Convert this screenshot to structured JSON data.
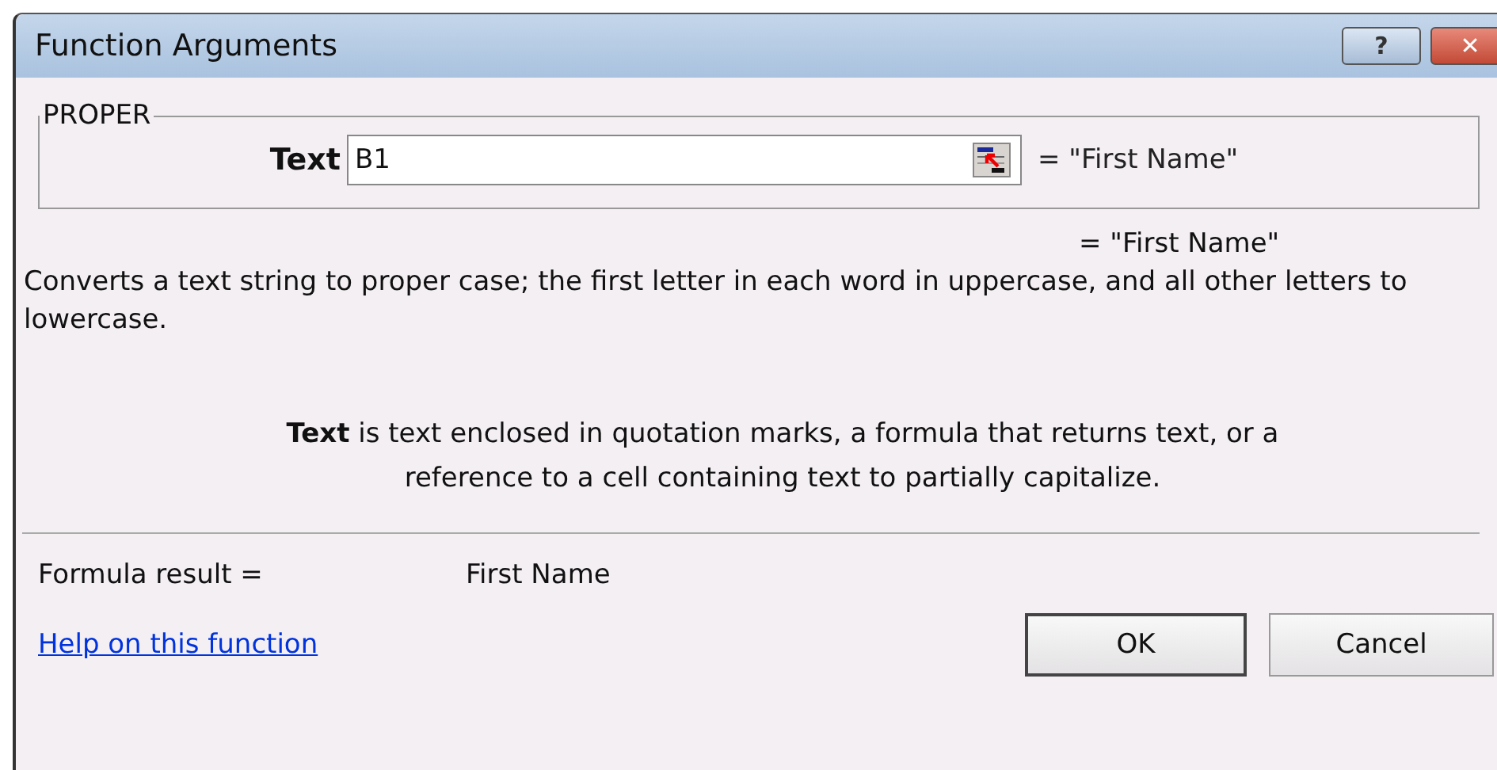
{
  "window": {
    "title": "Function Arguments",
    "help_button": "?",
    "close_button": "✕"
  },
  "function_group": {
    "title": "PROPER",
    "arguments": [
      {
        "label": "Text",
        "value": "B1",
        "result": "= \"First Name\""
      }
    ]
  },
  "function_result": "= \"First Name\"",
  "description": "Converts a text string to proper case; the first letter in each word in uppercase, and all other letters to lowercase.",
  "argument_help": {
    "name": "Text",
    "text": "is text enclosed in quotation marks, a formula that returns text, or a reference to a cell containing text to partially capitalize."
  },
  "formula_result": {
    "label": "Formula result =",
    "value": "First Name"
  },
  "help_link": "Help on this function",
  "buttons": [
    "OK",
    "Cancel"
  ]
}
